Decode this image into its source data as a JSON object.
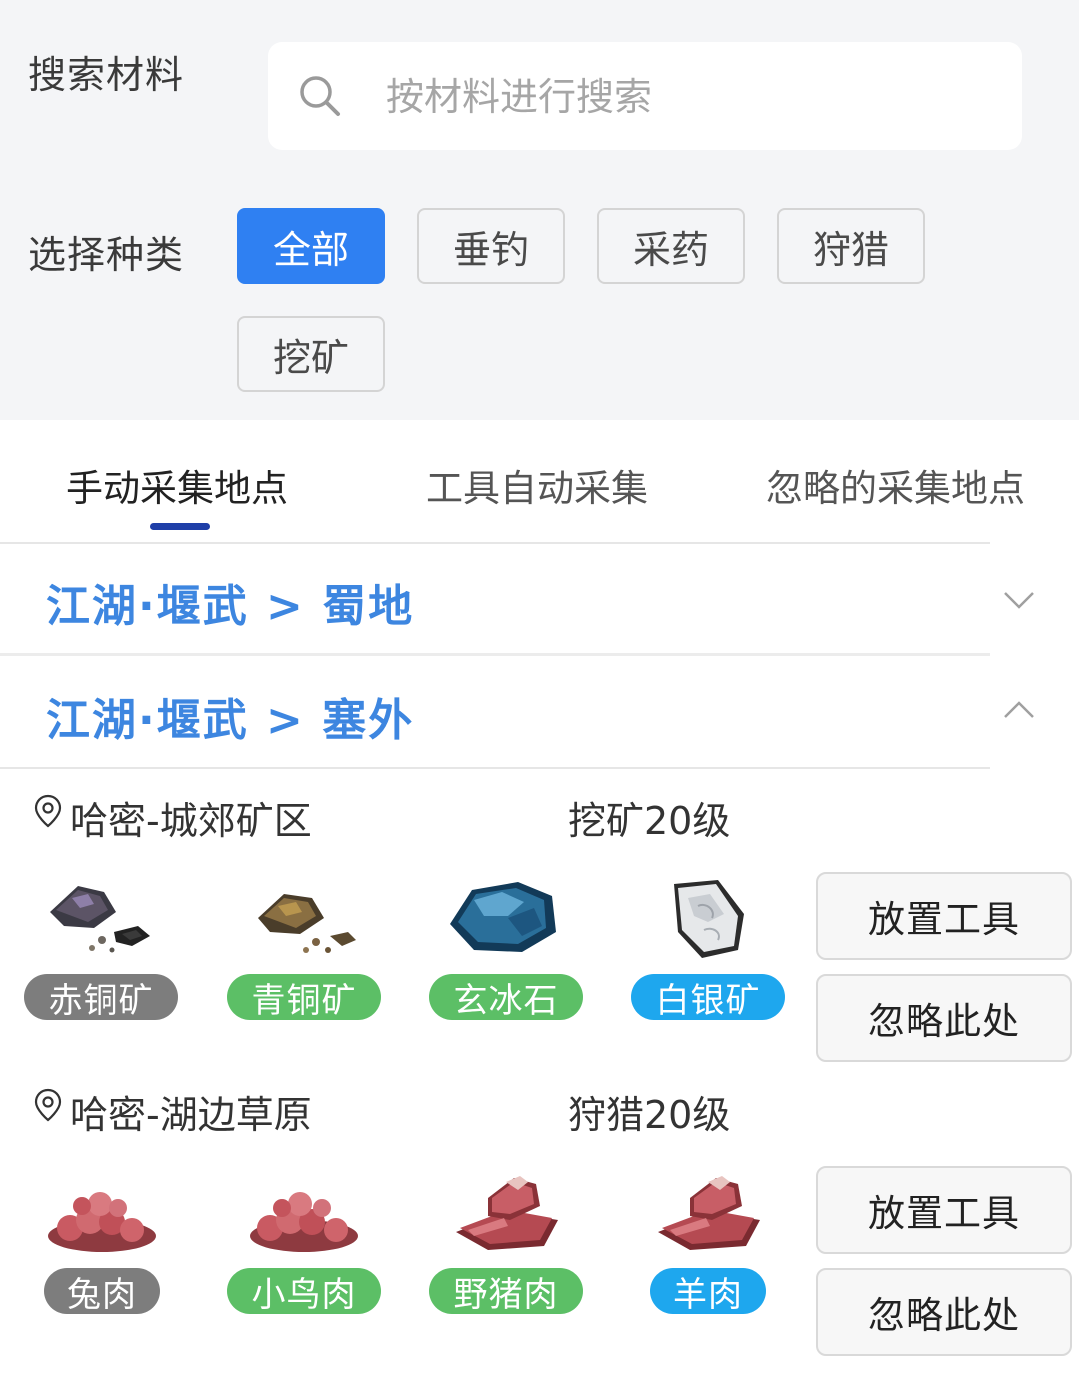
{
  "search": {
    "label": "搜索材料",
    "placeholder": "按材料进行搜索",
    "value": ""
  },
  "category": {
    "label": "选择种类",
    "chips": [
      "全部",
      "垂钓",
      "采药",
      "狩猎",
      "挖矿"
    ],
    "active": "全部"
  },
  "tabs": [
    "手动采集地点",
    "工具自动采集",
    "忽略的采集地点"
  ],
  "active_tab": "手动采集地点",
  "regions": [
    {
      "title": "江湖·堰武 > 蜀地",
      "expanded": false
    },
    {
      "title": "江湖·堰武 > 塞外",
      "expanded": true
    }
  ],
  "sites": [
    {
      "name": "哈密-城郊矿区",
      "level": "挖矿20级",
      "items": [
        {
          "name": "赤铜矿",
          "icon": "copper-ore-icon",
          "color": "#7d7d7d"
        },
        {
          "name": "青铜矿",
          "icon": "bronze-ore-icon",
          "color": "#5cbf66"
        },
        {
          "name": "玄冰石",
          "icon": "ice-stone-icon",
          "color": "#5cbf66"
        },
        {
          "name": "白银矿",
          "icon": "silver-ore-icon",
          "color": "#1ea7ee"
        }
      ],
      "buttons": [
        "放置工具",
        "忽略此处"
      ]
    },
    {
      "name": "哈密-湖边草原",
      "level": "狩猎20级",
      "items": [
        {
          "name": "兔肉",
          "icon": "rabbit-meat-icon",
          "color": "#7d7d7d"
        },
        {
          "name": "小鸟肉",
          "icon": "bird-meat-icon",
          "color": "#5cbf66"
        },
        {
          "name": "野猪肉",
          "icon": "boar-meat-icon",
          "color": "#5cbf66"
        },
        {
          "name": "羊肉",
          "icon": "mutton-icon",
          "color": "#1ea7ee"
        }
      ],
      "buttons": [
        "放置工具",
        "忽略此处"
      ]
    }
  ],
  "colors": {
    "accent": "#2f80f2",
    "region_title": "#3d86e0",
    "tab_indicator": "#1f3fa8"
  }
}
